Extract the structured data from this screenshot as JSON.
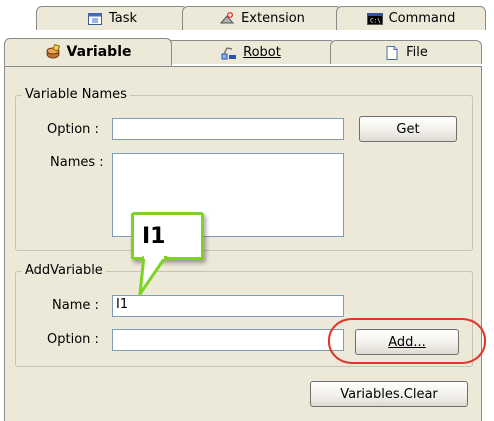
{
  "tabs_back": [
    {
      "label": "Task",
      "icon": "task-icon"
    },
    {
      "label": "Extension",
      "icon": "extension-icon"
    },
    {
      "label": "Command",
      "icon": "command-icon"
    }
  ],
  "tabs_front": [
    {
      "label": "Variable",
      "icon": "variable-icon",
      "active": true
    },
    {
      "label": "Robot",
      "icon": "robot-icon",
      "active": false
    },
    {
      "label": "File",
      "icon": "file-icon",
      "active": false
    }
  ],
  "variable_names": {
    "legend": "Variable Names",
    "option_label": "Option :",
    "option_value": "",
    "get_button": "Get",
    "names_label": "Names :",
    "names_value": ""
  },
  "add_variable": {
    "legend": "AddVariable",
    "name_label": "Name :",
    "name_value": "I1",
    "option_label": "Option :",
    "option_value": "",
    "add_button": "Add..."
  },
  "clear_button": "Variables.Clear",
  "callout": {
    "text": "I1",
    "color": "#7ed321"
  },
  "highlight_color": "#e0352b"
}
